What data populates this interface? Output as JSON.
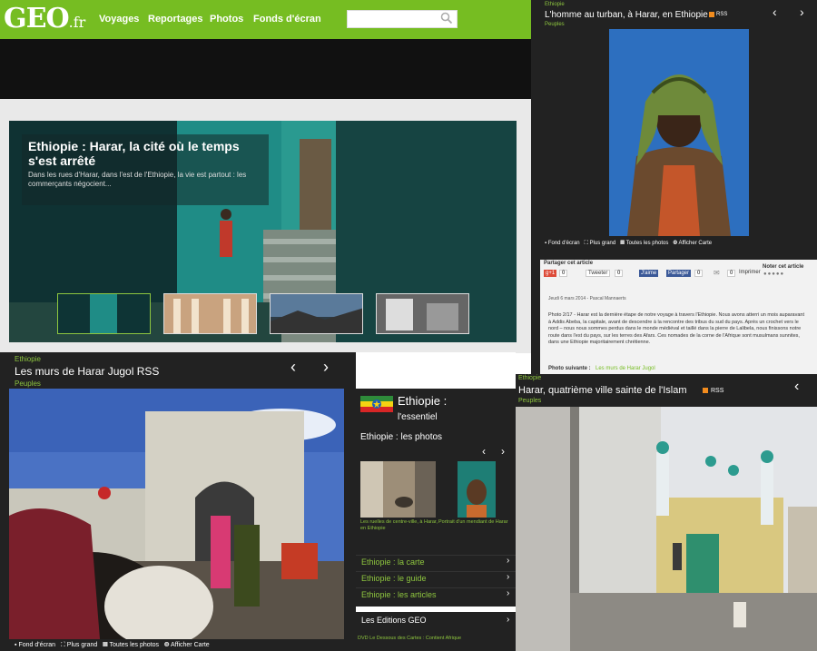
{
  "header": {
    "logo_main": "GEO",
    "logo_suffix": ".fr",
    "nav": [
      "Voyages",
      "Reportages",
      "Photos",
      "Fonds d'écran"
    ],
    "search_placeholder": ""
  },
  "hero": {
    "title": "Ethiopie : Harar, la cité où le temps s'est arrêté",
    "subtitle": "Dans les rues d'Harar, dans l'est de l'Ethiopie, la vie est partout : les commerçants négocient..."
  },
  "top_right": {
    "category": "Ethiopie",
    "title": "L'homme au turban, à Harar, en Ethiopie",
    "rss": "RSS",
    "tag": "Peuples",
    "toolbar": [
      "Fond d'écran",
      "Plus grand",
      "Toutes les photos",
      "Afficher Carte"
    ],
    "share_label": "Partager cet article",
    "rate_label": "Noter cet article",
    "gplus": "g+1",
    "gplus_count": "0",
    "tweet": "Tweeter",
    "tweet_count": "0",
    "like": "J'aime",
    "share_btn": "Partager",
    "fb_count": "0",
    "count_small": "0",
    "print": "Imprimer",
    "date": "Jeudi 6 mars 2014 - Pascal Mannaerts",
    "article": "Photo 2/17 - Harar est la dernière étape de notre voyage à travers l'Ethiopie. Nous avons atterri un mois auparavant à Addis Abeba, la capitale, avant de descendre à la rencontre des tribus du sud du pays. Après un crochet vers le nord – nous nous sommes perdus dans le monde médiéval et taillé dans la pierre de Lalibela, nous finissons notre route dans l'est du pays, sur les terres des Afars. Ces nomades de la corne de l'Afrique sont musulmans sunnites, dans une Ethiopie majoritairement chrétienne.",
    "next_label": "Photo suivante :",
    "next_link": "Les murs de Harar Jugol"
  },
  "bottom_left": {
    "category": "Ethiopie",
    "title": "Les murs de Harar Jugol  RSS",
    "tag": "Peuples",
    "toolbar": [
      "Fond d'écran",
      "Plus grand",
      "Toutes les photos",
      "Afficher Carte"
    ]
  },
  "side": {
    "title": "Ethiopie :",
    "subtitle": "l'essentiel",
    "photos_label": "Ethiopie : les photos",
    "caption1": "Les ruelles de centre-ville, à Harar, en Ethiopie",
    "caption2": "Portrait d'un mendiant de Harar",
    "links": [
      "Ethiopie : la carte",
      "Ethiopie : le guide",
      "Ethiopie : les articles"
    ],
    "editions": "Les Editions GEO",
    "footer": "DVD Le Dessous des Cartes : Contient Afrique"
  },
  "bottom_right": {
    "category": "Ethiopie",
    "title": "Harar, quatrième ville sainte de l'Islam",
    "rss": "RSS",
    "tag": "Peuples"
  }
}
